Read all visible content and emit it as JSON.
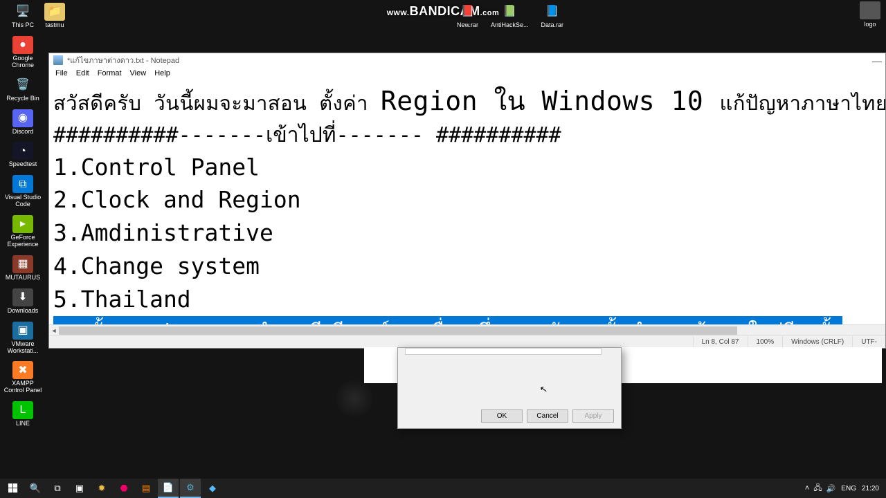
{
  "watermark": {
    "prefix": "www.",
    "brand": "BANDICAM",
    "suffix": ".com"
  },
  "desktop": {
    "left_icons": [
      {
        "name": "this-pc",
        "label": "This PC",
        "glyph": "🖥️",
        "bg": ""
      },
      {
        "name": "google-chrome",
        "label": "Google Chrome",
        "glyph": "●",
        "bg": "#ea4335"
      },
      {
        "name": "recycle-bin",
        "label": "Recycle Bin",
        "glyph": "🗑️",
        "bg": ""
      },
      {
        "name": "discord",
        "label": "Discord",
        "glyph": "◉",
        "bg": "#5865f2"
      },
      {
        "name": "speedtest",
        "label": "Speedtest",
        "glyph": "◔",
        "bg": "#141526"
      },
      {
        "name": "visual-studio-code",
        "label": "Visual Studio Code",
        "glyph": "⧉",
        "bg": "#0078d7"
      },
      {
        "name": "geforce-experience",
        "label": "GeForce Experience",
        "glyph": "▸",
        "bg": "#76b900"
      },
      {
        "name": "mutaurus",
        "label": "MUTAURUS",
        "glyph": "▦",
        "bg": "#8b3a2a"
      },
      {
        "name": "downloads",
        "label": "Downloads",
        "glyph": "⬇",
        "bg": "#444"
      },
      {
        "name": "vmware",
        "label": "VMware Workstati...",
        "glyph": "▣",
        "bg": "#1a6ea0"
      },
      {
        "name": "xampp",
        "label": "XAMPP Control Panel",
        "glyph": "✖",
        "bg": "#fb7a24"
      },
      {
        "name": "line",
        "label": "LINE",
        "glyph": "L",
        "bg": "#00c300"
      }
    ],
    "top_icons": [
      {
        "name": "new-rar",
        "label": "New.rar",
        "glyph": "📕"
      },
      {
        "name": "antihack",
        "label": "AntiHackSe...",
        "glyph": "📗"
      },
      {
        "name": "data-rar",
        "label": "Data.rar",
        "glyph": "📘"
      }
    ],
    "left2": {
      "name": "tastmu",
      "label": "tastmu",
      "glyph": "📁"
    },
    "right_icon": {
      "name": "logo",
      "label": "logo"
    }
  },
  "notepad": {
    "title": "*แก้ไขภาษาต่างดาว.txt - Notepad",
    "menu": [
      "File",
      "Edit",
      "Format",
      "View",
      "Help"
    ],
    "lines": {
      "l1a": "สวัสดีครับ วันนี้ผมจะมาสอน ตั้งค่า ",
      "l1b": "Region",
      "l1c": " ใน Windows 10 ",
      "l1d": "แก้ปัญหาภาษาไทยต่างดาวใน",
      "l2": "##########-------เข้าไปที่-------  ##########",
      "l3": "1.Control Panel",
      "l4": "2.Clock and Region",
      "l5": "3.Amdinistrative",
      "l6": "4.Change system",
      "l7": "5.Thailand",
      "sel": "จากนั้นกด ok  ระบบจะทำการรี รีสตาร์ท เครื่องหนึ่งรอบหลังจากนั้นทำการเข้าเกมใหม่อีกครั้ง"
    },
    "status": {
      "pos": "Ln 8, Col 87",
      "zoom": "100%",
      "crlf": "Windows (CRLF)",
      "enc": "UTF-"
    }
  },
  "dialog": {
    "ok": "OK",
    "cancel": "Cancel",
    "apply": "Apply"
  },
  "taskbar": {
    "lang": "ENG",
    "time": "21:20",
    "tray_up": "˄"
  }
}
